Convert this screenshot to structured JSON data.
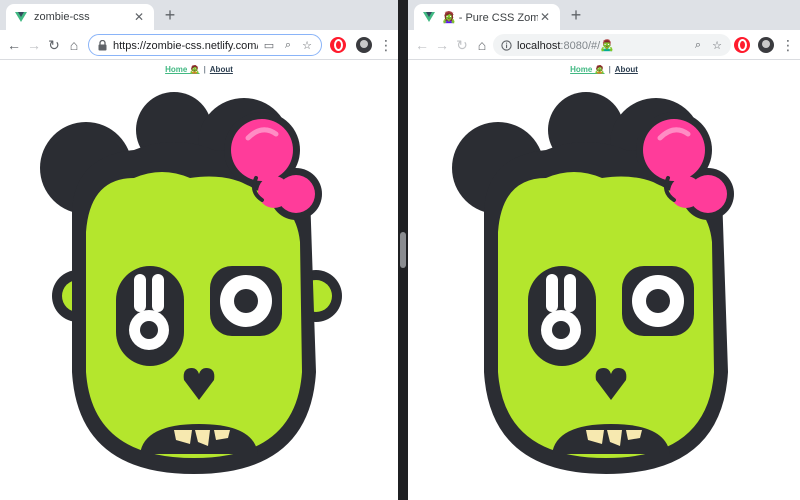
{
  "left_window": {
    "tab_title": "zombie-css",
    "url_host": "https://zombie-css.netlify.com",
    "url_path": "/#/🧟",
    "nav": {
      "home": "Home 🧟",
      "separator": "|",
      "about": "About"
    }
  },
  "right_window": {
    "tab_title": "🧟‍♀️ - Pure CSS Zombie - 🧟‍♂️",
    "url_host": "localhost",
    "url_path": ":8080/#/🧟‍♂",
    "nav": {
      "home": "Home 🧟",
      "separator": "|",
      "about": "About"
    }
  },
  "icons": {
    "back": "←",
    "forward": "→",
    "reload": "↻",
    "home": "⌂",
    "close": "✕",
    "new_tab": "+",
    "bookmark_star": "☆",
    "zoom": "⌕",
    "cast": "▭",
    "menu": "⋮"
  },
  "colors": {
    "zombie_green": "#b4e62d",
    "outline": "#2b2d33",
    "brain_pink": "#ff3c9a",
    "teeth": "#f7e9b0",
    "link_green": "#42b983",
    "link_dark": "#2c3e50"
  }
}
